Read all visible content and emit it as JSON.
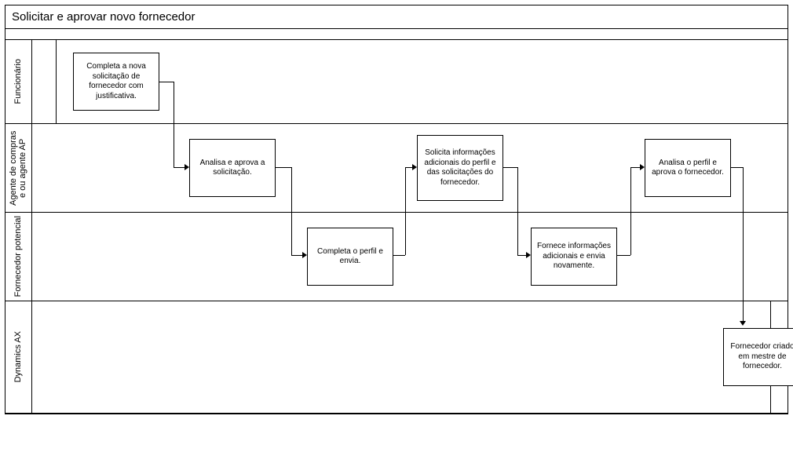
{
  "title": "Solicitar e aprovar novo fornecedor",
  "lanes": [
    {
      "label": "Funcionário"
    },
    {
      "label": "Agente de compras e ou agente AP"
    },
    {
      "label": "Fornecedor potencial"
    },
    {
      "label": "Dynamics AX"
    }
  ],
  "tasks": {
    "t1": "Completa a nova solicitação de fornecedor com justificativa.",
    "t2": "Analisa e aprova a solicitação.",
    "t3": "Completa o perfil e envia.",
    "t4": "Solicita informações adicionais do perfil e das solicitações do fornecedor.",
    "t5": "Fornece informações adicionais e envia novamente.",
    "t6": "Analisa o perfil e aprova o fornecedor.",
    "t7": "Fornecedor criado em mestre de fornecedor."
  },
  "chart_data": {
    "type": "swimlane-flow",
    "title": "Solicitar e aprovar novo fornecedor",
    "lanes": [
      "Funcionário",
      "Agente de compras e ou agente AP",
      "Fornecedor potencial",
      "Dynamics AX"
    ],
    "steps": [
      {
        "id": "t1",
        "lane": "Funcionário",
        "label": "Completa a nova solicitação de fornecedor com justificativa."
      },
      {
        "id": "t2",
        "lane": "Agente de compras e ou agente AP",
        "label": "Analisa e aprova a solicitação."
      },
      {
        "id": "t3",
        "lane": "Fornecedor potencial",
        "label": "Completa o perfil e envia."
      },
      {
        "id": "t4",
        "lane": "Agente de compras e ou agente AP",
        "label": "Solicita informações adicionais do perfil e das solicitações do fornecedor."
      },
      {
        "id": "t5",
        "lane": "Fornecedor potencial",
        "label": "Fornece informações adicionais e envia novamente."
      },
      {
        "id": "t6",
        "lane": "Agente de compras e ou agente AP",
        "label": "Analisa o perfil e aprova o fornecedor."
      },
      {
        "id": "t7",
        "lane": "Dynamics AX",
        "label": "Fornecedor criado em mestre de fornecedor."
      }
    ],
    "flows": [
      [
        "t1",
        "t2"
      ],
      [
        "t2",
        "t3"
      ],
      [
        "t3",
        "t4"
      ],
      [
        "t4",
        "t5"
      ],
      [
        "t5",
        "t6"
      ],
      [
        "t6",
        "t7"
      ]
    ]
  }
}
